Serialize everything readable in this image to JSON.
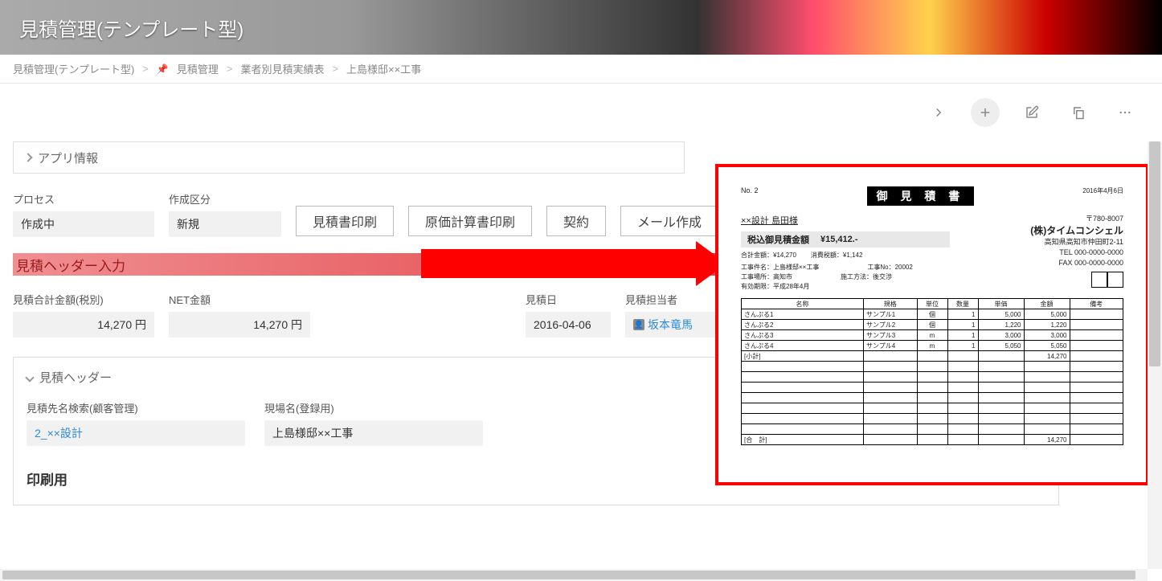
{
  "banner": {
    "title": "見積管理(テンプレート型)"
  },
  "breadcrumbs": {
    "items": [
      "見積管理(テンプレート型)",
      "見積管理",
      "業者別見積実績表",
      "上島様邸××工事"
    ]
  },
  "appInfo": {
    "label": "アプリ情報"
  },
  "process": {
    "label": "プロセス",
    "value": "作成中"
  },
  "kubun": {
    "label": "作成区分",
    "value": "新規"
  },
  "buttons": {
    "print": "見積書印刷",
    "cost": "原価計算書印刷",
    "contract": "契約",
    "mail": "メール作成"
  },
  "sectionHeaderInput": "見積ヘッダー入力",
  "totals": {
    "sumLabel": "見積合計金額(税別)",
    "sumValue": "14,270 円",
    "netLabel": "NET金額",
    "netValue": "14,270 円",
    "dateLabel": "見積日",
    "dateValue": "2016-04-06",
    "personLabel": "見積担当者",
    "personValue": "坂本竜馬"
  },
  "headerCard": {
    "title": "見積ヘッダー",
    "searchLabel": "見積先名検索(顧客管理)",
    "searchValue": "2_××設計",
    "genbaLabel": "現場名(登録用)",
    "genbaValue": "上島様邸××工事"
  },
  "printSection": {
    "title": "印刷用"
  },
  "quote": {
    "no": "No. 2",
    "title": "御 見 積 書",
    "date": "2016年4月6日",
    "client": "××設計  島田様",
    "postal": "〒780-8007",
    "company": "(株)タイムコンシェル",
    "addr": "高知県高知市仲田町2-11",
    "tel": "TEL 000-0000-0000",
    "fax": "FAX 000-0000-0000",
    "totalLabel": "税込御見積金額",
    "totalValue": "¥15,412.-",
    "subTotal": "合計金額：¥14,270",
    "tax": "消費税額：¥1,142",
    "kojiName": "工事件名：上島様邸××工事",
    "kojiNoLabel": "工事No：20002",
    "kojiBasho": "工事場所：高知市",
    "exec": "施工方法：後交渉",
    "validity": "有効期限：平成28年4月",
    "headers": [
      "名称",
      "規格",
      "単位",
      "数量",
      "単価",
      "金額",
      "備考"
    ],
    "rows": [
      {
        "a": "さんぷる1",
        "b": "サンプル1",
        "c": "個",
        "d": "1",
        "e": "5,000",
        "f": "5,000"
      },
      {
        "a": "さんぷる2",
        "b": "サンプル2",
        "c": "個",
        "d": "1",
        "e": "1,220",
        "f": "1,220"
      },
      {
        "a": "さんぷる3",
        "b": "サンプル3",
        "c": "m",
        "d": "1",
        "e": "3,000",
        "f": "3,000"
      },
      {
        "a": "さんぷる4",
        "b": "サンプル4",
        "c": "m",
        "d": "1",
        "e": "5,050",
        "f": "5,050"
      }
    ],
    "subtotalLabel": "[小計]",
    "subtotalValue": "14,270",
    "footerLeft": "[合　計]",
    "footerRight": "14,270"
  }
}
